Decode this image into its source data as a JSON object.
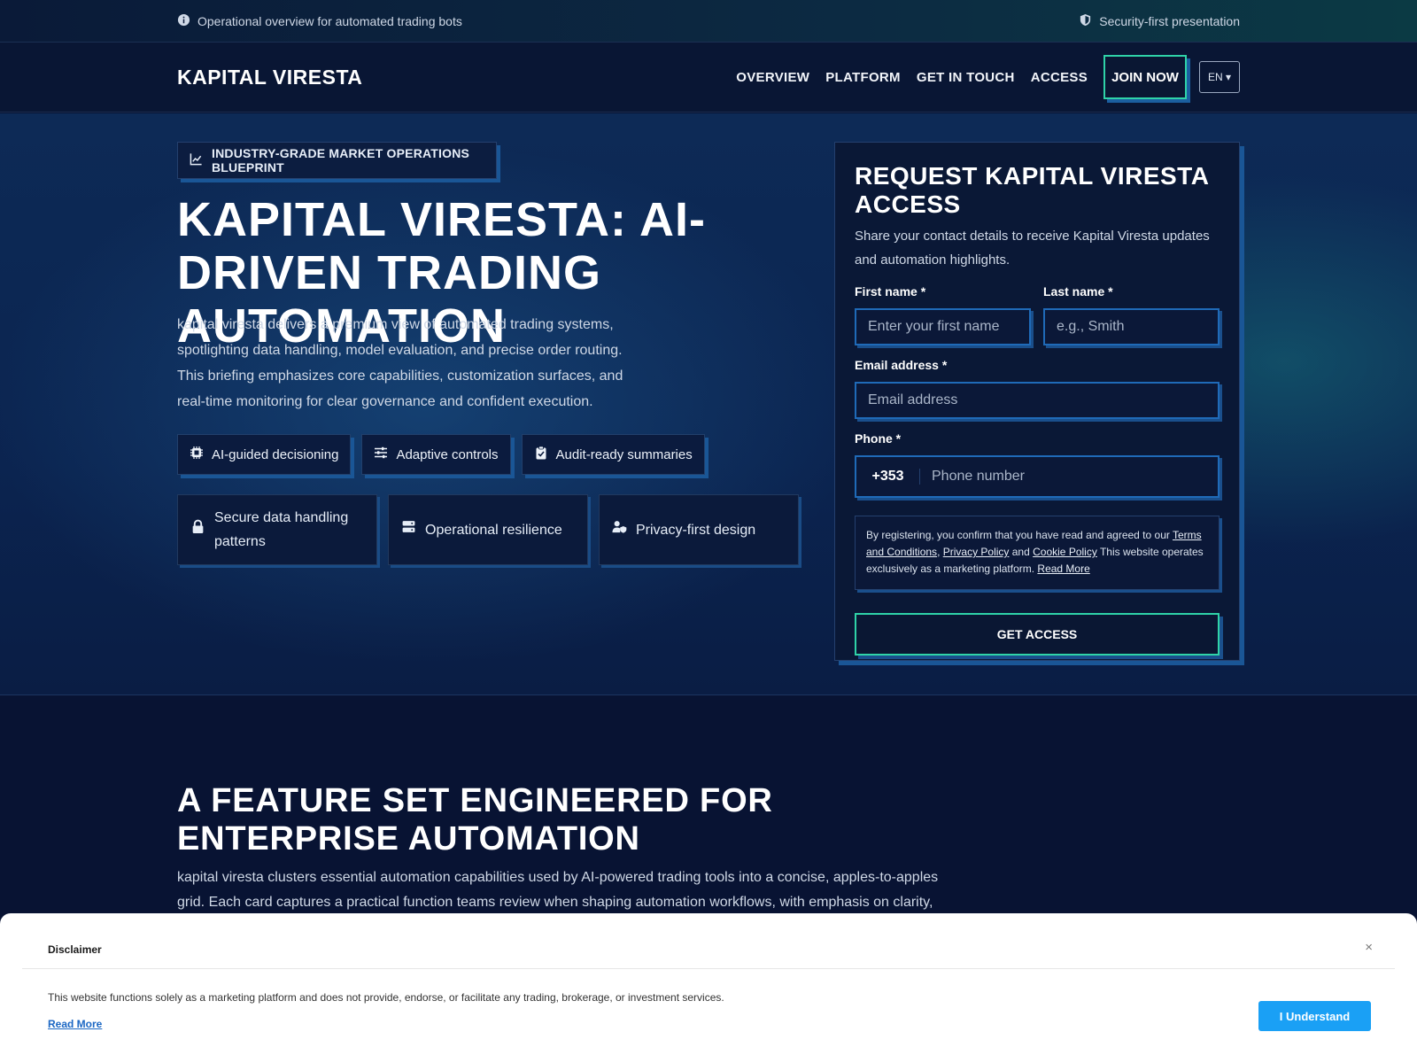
{
  "topbar": {
    "left_text": "Operational overview for automated trading bots",
    "right_text": "Security-first presentation"
  },
  "nav": {
    "brand": "KAPITAL VIRESTA",
    "links": [
      "OVERVIEW",
      "PLATFORM",
      "GET IN TOUCH",
      "ACCESS"
    ],
    "join": "JOIN NOW",
    "lang": "EN ▾"
  },
  "hero": {
    "badge": "INDUSTRY-GRADE MARKET OPERATIONS BLUEPRINT",
    "title": "KAPITAL VIRESTA: AI-DRIVEN TRADING AUTOMATION",
    "description": "kapital viresta delivers a premium view of automated trading systems, spotlighting data handling, model evaluation, and precise order routing. This briefing emphasizes core capabilities, customization surfaces, and real-time monitoring for clear governance and confident execution.",
    "chips": [
      {
        "label": "AI-guided decisioning",
        "icon": "chip-icon"
      },
      {
        "label": "Adaptive controls",
        "icon": "sliders-icon"
      },
      {
        "label": "Audit-ready summaries",
        "icon": "clipboard-check-icon"
      }
    ],
    "cards": [
      {
        "label": "Secure data handling patterns",
        "icon": "lock-icon"
      },
      {
        "label": "Operational resilience",
        "icon": "server-icon"
      },
      {
        "label": "Privacy-first design",
        "icon": "user-shield-icon"
      }
    ]
  },
  "form": {
    "title": "REQUEST KAPITAL VIRESTA ACCESS",
    "subtitle": "Share your contact details to receive Kapital Viresta updates and automation highlights.",
    "first_name_label": "First name *",
    "first_name_placeholder": "Enter your first name",
    "last_name_label": "Last name *",
    "last_name_placeholder": "e.g., Smith",
    "email_label": "Email address *",
    "email_placeholder": "Email address",
    "phone_label": "Phone *",
    "phone_code": "+353",
    "phone_placeholder": "Phone number",
    "consent_prefix": "By registering, you confirm that you have read and agreed to our ",
    "terms": "Terms and Conditions",
    "comma": ", ",
    "privacy": "Privacy Policy",
    "and": " and ",
    "cookie": "Cookie Policy",
    "consent_suffix": " This website operates exclusively as a marketing platform. ",
    "read_more": "Read More",
    "submit": "GET ACCESS"
  },
  "features": {
    "title": "A FEATURE SET ENGINEERED FOR ENTERPRISE AUTOMATION",
    "description": "kapital viresta clusters essential automation capabilities used by AI-powered trading tools into a concise, apples-to-apples grid. Each card captures a practical function teams review when shaping automation workflows, with emphasis on clarity, configurability, and monitoring-ready outputs."
  },
  "disclaimer": {
    "title": "Disclaimer",
    "close": "×",
    "text": "This website functions solely as a marketing platform and does not provide, endorse, or facilitate any trading, brokerage, or investment services.",
    "read_more": "Read More",
    "button": "I Understand"
  }
}
